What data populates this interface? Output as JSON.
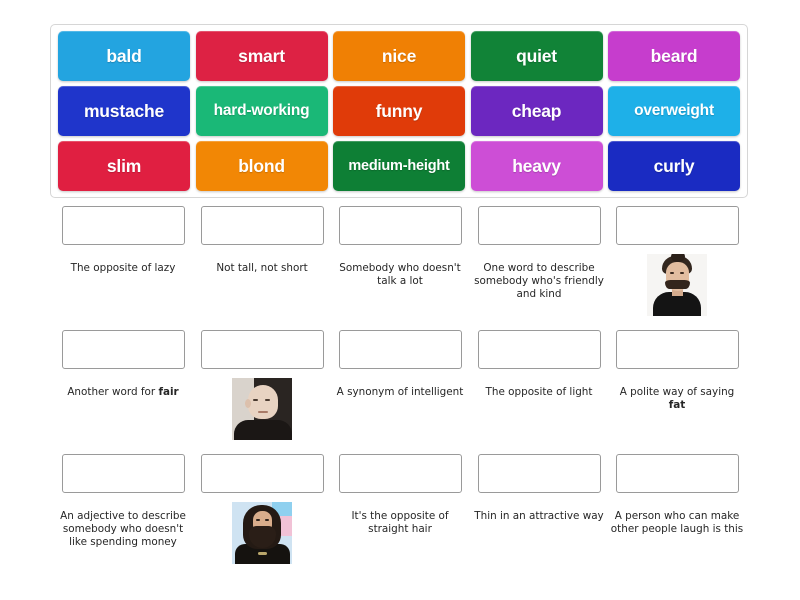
{
  "word_bank": {
    "rows": [
      [
        {
          "label": "bald",
          "color": "#23a4e0",
          "size": "normal"
        },
        {
          "label": "smart",
          "color": "#dd2244",
          "size": "normal"
        },
        {
          "label": "nice",
          "color": "#f08004",
          "size": "normal"
        },
        {
          "label": "quiet",
          "color": "#118337",
          "size": "normal"
        },
        {
          "label": "beard",
          "color": "#c63dcd",
          "size": "normal"
        }
      ],
      [
        {
          "label": "mustache",
          "color": "#1f35cb",
          "size": "normal"
        },
        {
          "label": "hard-working",
          "color": "#1ab877",
          "size": "small"
        },
        {
          "label": "funny",
          "color": "#e03b09",
          "size": "normal"
        },
        {
          "label": "cheap",
          "color": "#6c27c0",
          "size": "normal"
        },
        {
          "label": "overweight",
          "color": "#1eb0e8",
          "size": "small"
        }
      ],
      [
        {
          "label": "slim",
          "color": "#e01f41",
          "size": "normal"
        },
        {
          "label": "blond",
          "color": "#f28705",
          "size": "normal"
        },
        {
          "label": "medium-height",
          "color": "#0e7f35",
          "size": "xsmall"
        },
        {
          "label": "heavy",
          "color": "#cd4ed6",
          "size": "normal"
        },
        {
          "label": "curly",
          "color": "#1a2bc2",
          "size": "normal"
        }
      ]
    ]
  },
  "answers": {
    "rows": [
      [
        {
          "caption": "The opposite of lazy",
          "bold": "",
          "photo": ""
        },
        {
          "caption": "Not tall, not short",
          "bold": "",
          "photo": ""
        },
        {
          "caption": "Somebody who doesn't talk a lot",
          "bold": "",
          "photo": ""
        },
        {
          "caption": "One word to describe somebody who's friendly and kind",
          "bold": "",
          "photo": ""
        },
        {
          "caption": "",
          "bold": "",
          "photo": "photo-man-with-mustache"
        }
      ],
      [
        {
          "caption": "Another word for ",
          "bold": "fair",
          "photo": ""
        },
        {
          "caption": "",
          "bold": "",
          "photo": "photo-bald-man"
        },
        {
          "caption": "A synonym of intelligent",
          "bold": "",
          "photo": ""
        },
        {
          "caption": "The opposite of light",
          "bold": "",
          "photo": ""
        },
        {
          "caption": "A polite way of saying ",
          "bold": "fat",
          "photo": ""
        }
      ],
      [
        {
          "caption": "An adjective to describe somebody who doesn't like spending money",
          "bold": "",
          "photo": ""
        },
        {
          "caption": "",
          "bold": "",
          "photo": "photo-bearded-long-hair-man"
        },
        {
          "caption": "It's the opposite of straight hair",
          "bold": "",
          "photo": ""
        },
        {
          "caption": "Thin in an attractive way",
          "bold": "",
          "photo": ""
        },
        {
          "caption": "A person who can make other people laugh is this",
          "bold": "",
          "photo": ""
        }
      ]
    ]
  }
}
